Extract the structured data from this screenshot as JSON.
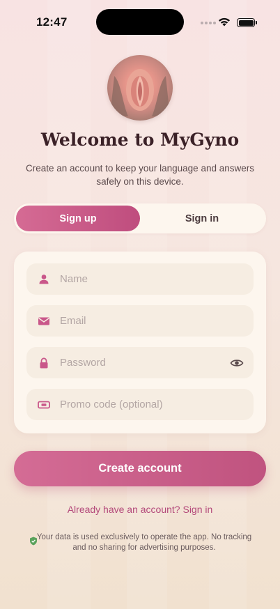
{
  "status_bar": {
    "time": "12:47"
  },
  "welcome": {
    "title": "Welcome to MyGyno",
    "subtitle": "Create an account to keep your language and answers safely on this device."
  },
  "tabs": {
    "signup_label": "Sign up",
    "signin_label": "Sign in",
    "selected": "Sign up"
  },
  "form": {
    "name_placeholder": "Name",
    "email_placeholder": "Email",
    "password_placeholder": "Password",
    "promo_placeholder": "Promo code (optional)"
  },
  "actions": {
    "create_account_label": "Create account",
    "signin_link_label": "Already have an account? Sign in"
  },
  "privacy_note": "Your data is used exclusively to operate the app. No tracking and no sharing for advertising purposes.",
  "icons": {
    "name": "person-icon",
    "email": "envelope-icon",
    "password": "lock-icon",
    "promo": "ticket-icon",
    "toggle": "eye-icon",
    "privacy": "shield-icon"
  },
  "colors": {
    "accent": "#c9578a",
    "link": "#b3487a",
    "card": "#fdf6ee",
    "field": "#f6ede2"
  }
}
